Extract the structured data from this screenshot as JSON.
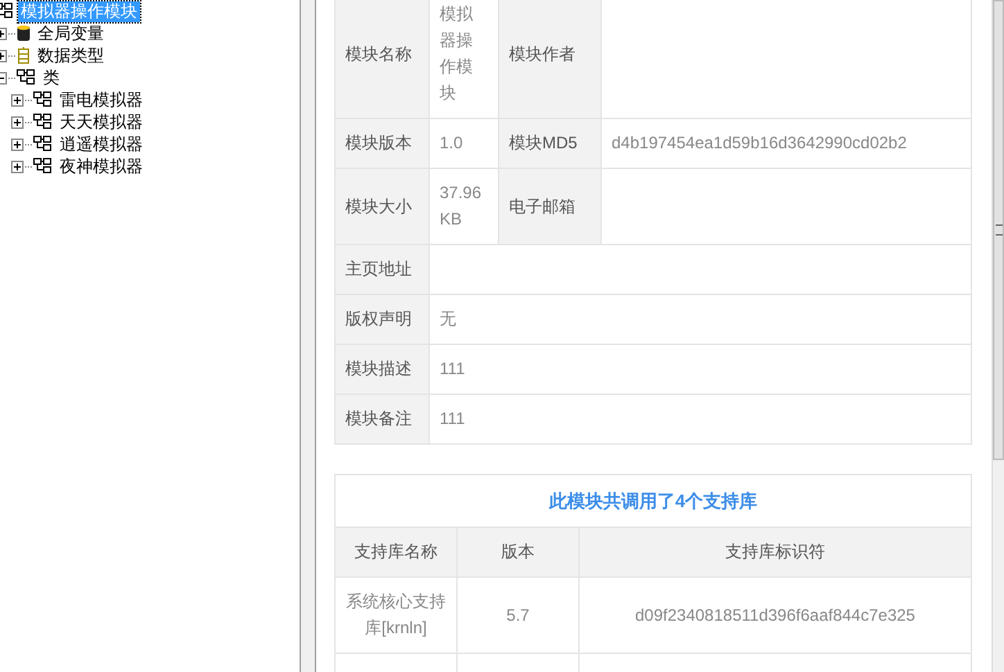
{
  "tree": {
    "label": "模拟器操作模块",
    "kind": "module",
    "selected": true,
    "children": [
      {
        "label": "全局变量",
        "kind": "globals",
        "selected": false,
        "expanded": false
      },
      {
        "label": "数据类型",
        "kind": "types",
        "selected": false,
        "expanded": false
      },
      {
        "label": "类",
        "kind": "class",
        "selected": false,
        "expanded": true,
        "children": [
          {
            "label": "雷电模拟器",
            "kind": "class",
            "selected": false,
            "expanded": false
          },
          {
            "label": "天天模拟器",
            "kind": "class",
            "selected": false,
            "expanded": false
          },
          {
            "label": "逍遥模拟器",
            "kind": "class",
            "selected": false,
            "expanded": false
          },
          {
            "label": "夜神模拟器",
            "kind": "class",
            "selected": false,
            "expanded": false
          }
        ]
      }
    ]
  },
  "info_table": {
    "rows": [
      {
        "cells": [
          {
            "kind": "label",
            "text": "模块名称"
          },
          {
            "kind": "value",
            "text": "模拟器操作模块"
          },
          {
            "kind": "label",
            "text": "模块作者"
          },
          {
            "kind": "value"
          }
        ]
      },
      {
        "cells": [
          {
            "kind": "label",
            "text": "模块版本"
          },
          {
            "kind": "value",
            "text": "1.0"
          },
          {
            "kind": "label",
            "text": "模块MD5"
          },
          {
            "kind": "value",
            "text": "d4b197454ea1d59b16d3642990cd02b2"
          }
        ]
      },
      {
        "cells": [
          {
            "kind": "label",
            "text": "模块大小"
          },
          {
            "kind": "value",
            "text": "37.96 KB"
          },
          {
            "kind": "label",
            "text": "电子邮箱"
          },
          {
            "kind": "value"
          }
        ]
      },
      {
        "cells": [
          {
            "kind": "label",
            "text": "主页地址"
          },
          {
            "kind": "value",
            "colspan": 3
          }
        ]
      },
      {
        "cells": [
          {
            "kind": "label",
            "text": "版权声明"
          },
          {
            "kind": "value",
            "text": "无",
            "colspan": 3
          }
        ]
      },
      {
        "cells": [
          {
            "kind": "label",
            "text": "模块描述"
          },
          {
            "kind": "value",
            "text": "111",
            "colspan": 3
          }
        ]
      },
      {
        "cells": [
          {
            "kind": "label",
            "text": "模块备注"
          },
          {
            "kind": "value",
            "text": "111",
            "colspan": 3
          }
        ]
      }
    ]
  },
  "library_table": {
    "title": "此模块共调用了4个支持库",
    "columns": [
      "支持库名称",
      "版本",
      "支持库标识符"
    ],
    "rows": [
      [
        "系统核心支持库[krnln]",
        "5.7",
        "d09f2340818511d396f6aaf844c7e325"
      ]
    ]
  }
}
